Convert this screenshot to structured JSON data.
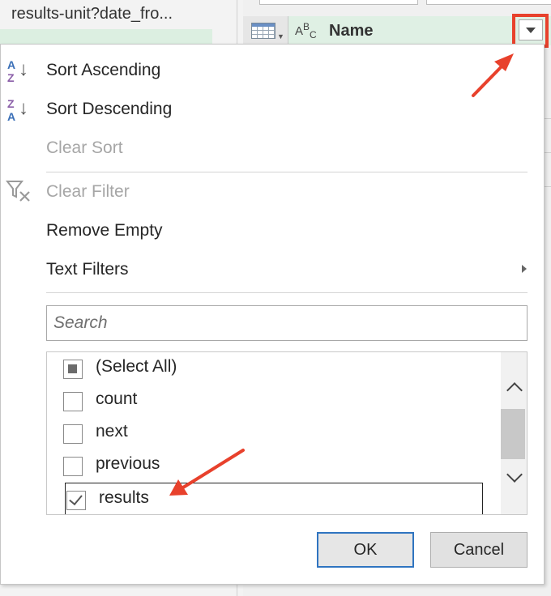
{
  "query_pane": {
    "title": "results-unit?date_fro..."
  },
  "column": {
    "type_icon_label": "ABC",
    "name": "Name"
  },
  "menu": {
    "sort_ascending": "Sort Ascending",
    "sort_descending": "Sort Descending",
    "clear_sort": "Clear Sort",
    "clear_filter": "Clear Filter",
    "remove_empty": "Remove Empty",
    "text_filters": "Text Filters"
  },
  "search": {
    "placeholder": "Search",
    "value": ""
  },
  "filter_list": {
    "items": [
      {
        "label": "(Select All)",
        "state": "partial"
      },
      {
        "label": "count",
        "state": "unchecked"
      },
      {
        "label": "next",
        "state": "unchecked"
      },
      {
        "label": "previous",
        "state": "unchecked"
      },
      {
        "label": "results",
        "state": "checked"
      }
    ]
  },
  "buttons": {
    "ok": "OK",
    "cancel": "Cancel"
  },
  "icons": {
    "sort_ascending": "sort-az-icon",
    "sort_descending": "sort-za-icon",
    "clear_filter": "clear-filter-icon",
    "column_type": "text-type-icon",
    "table": "table-icon",
    "dropdown": "chevron-down-icon"
  },
  "colors": {
    "annotation_red": "#e8412c",
    "header_green": "#dff0e4",
    "ok_border": "#2f74c0"
  }
}
